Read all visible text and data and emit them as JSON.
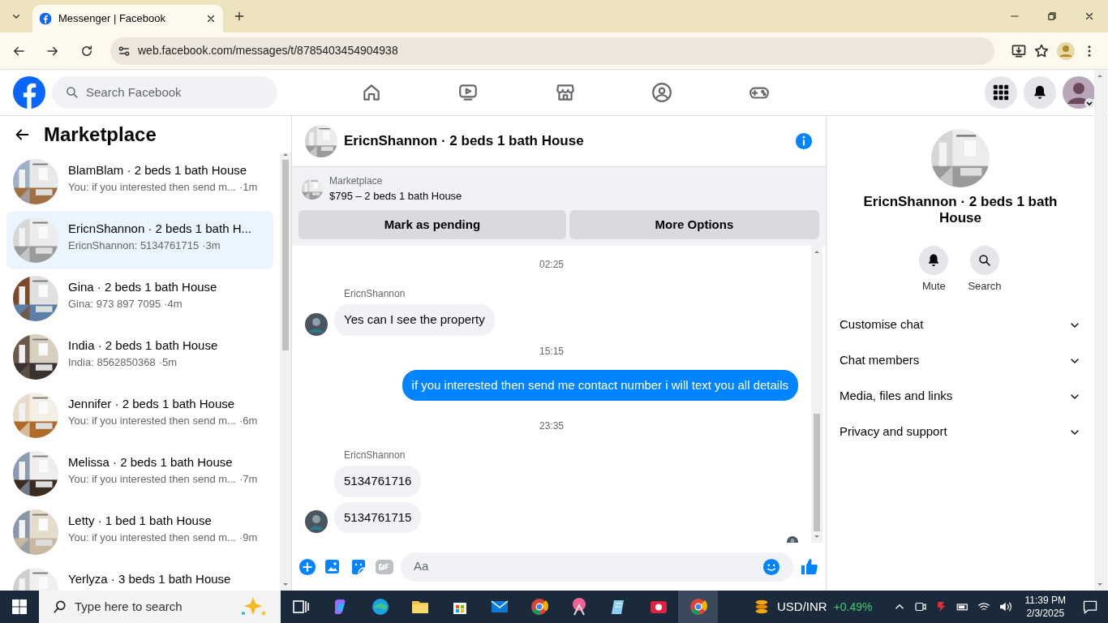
{
  "browser": {
    "tab_title": "Messenger | Facebook",
    "url": "web.facebook.com/messages/t/8785403454904938"
  },
  "header": {
    "search_placeholder": "Search Facebook"
  },
  "left": {
    "title": "Marketplace",
    "threads": [
      {
        "title": "BlamBlam · 2 beds 1 bath House",
        "preview": "You: if you interested then send m...",
        "time": "·1m",
        "selected": false
      },
      {
        "title": "EricnShannon · 2 beds 1 bath H...",
        "preview": "EricnShannon: 5134761715",
        "time": "·3m",
        "selected": true
      },
      {
        "title": "Gina · 2 beds 1 bath House",
        "preview": "Gina: 973 897 7095",
        "time": "·4m",
        "selected": false
      },
      {
        "title": "India · 2 beds 1 bath House",
        "preview": "India: 8562850368",
        "time": "·5m",
        "selected": false
      },
      {
        "title": "Jennifer · 2 beds 1 bath House",
        "preview": "You: if you interested then send m...",
        "time": "·6m",
        "selected": false
      },
      {
        "title": "Melissa · 2 beds 1 bath House",
        "preview": "You: if you interested then send m...",
        "time": "·7m",
        "selected": false
      },
      {
        "title": "Letty · 1 bed 1 bath House",
        "preview": "You: if you interested then send m...",
        "time": "·9m",
        "selected": false
      },
      {
        "title": "Yerlyza · 3 beds 1 bath House",
        "selected": false
      }
    ]
  },
  "chat": {
    "title": "EricnShannon · 2 beds 1 bath House",
    "listing_label": "Marketplace",
    "listing_title": "$795 – 2 beds 1 bath House",
    "actions": [
      "Mark as pending",
      "More Options"
    ],
    "messages": [
      {
        "kind": "time",
        "text": "02:25"
      },
      {
        "kind": "sender",
        "text": "EricnShannon"
      },
      {
        "kind": "incoming",
        "text": "Yes can I see the property",
        "avatar": true
      },
      {
        "kind": "time",
        "text": "15:15"
      },
      {
        "kind": "outgoing",
        "text": "if you interested then send me contact number i will text you all details"
      },
      {
        "kind": "time",
        "text": "23:35"
      },
      {
        "kind": "sender",
        "text": "EricnShannon"
      },
      {
        "kind": "incoming",
        "text": "5134761716",
        "avatar": false
      },
      {
        "kind": "incoming",
        "text": "5134761715",
        "avatar": true
      },
      {
        "kind": "seen"
      }
    ],
    "composer_placeholder": "Aa"
  },
  "info": {
    "title": "EricnShannon · 2 beds 1 bath House",
    "buttons": [
      "Mute",
      "Search"
    ],
    "sections": [
      "Customise chat",
      "Chat members",
      "Media, files and links",
      "Privacy and support"
    ]
  },
  "taskbar": {
    "search_placeholder": "Type here to search",
    "ticker": "USD/INR",
    "change": "+0.49%",
    "time": "11:39 PM",
    "date": "2/3/2025"
  }
}
